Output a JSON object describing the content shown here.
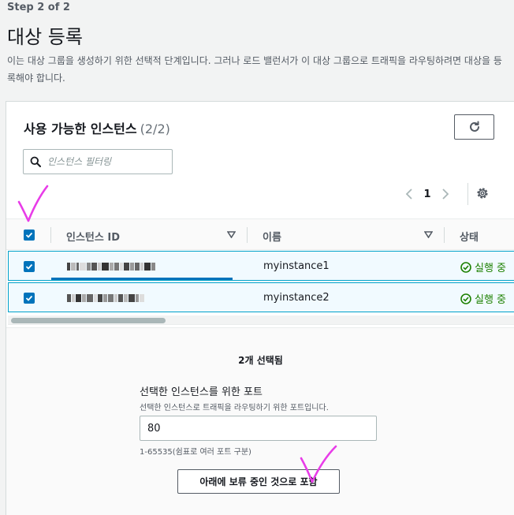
{
  "header": {
    "step": "Step 2 of 2",
    "title": "대상 등록",
    "description": "이는 대상 그룹을 생성하기 위한 선택적 단계입니다. 그러나 로드 밸런서가 이 대상 그룹으로 트래픽을 라우팅하려면 대상을 등록해야 합니다."
  },
  "instances_panel": {
    "title": "사용 가능한 인스턴스",
    "count": "(2/2)",
    "filter_placeholder": "인스턴스 필터링",
    "pagination": {
      "current_page": "1"
    },
    "columns": [
      "인스턴스 ID",
      "이름",
      "상태"
    ],
    "rows": [
      {
        "checked": true,
        "instance_id_redacted": true,
        "name": "myinstance1",
        "status": "실행 중"
      },
      {
        "checked": true,
        "instance_id_redacted": true,
        "name": "myinstance2",
        "status": "실행 중"
      }
    ],
    "header_checkbox_checked": true
  },
  "selection": {
    "selected_count_label": "2개 선택됨",
    "port_label": "선택한 인스턴스를 위한 포트",
    "port_description": "선택한 인스턴스로 트래픽을 라우팅하기 위한 포트입니다.",
    "port_value": "80",
    "port_hint": "1-65535(쉼표로 여러 포트 구분)",
    "include_button": "아래에 보류 중인 것으로 포함"
  },
  "icons": {
    "refresh": "refresh-icon",
    "search": "search-icon",
    "settings": "gear-icon",
    "prev": "chevron-left-icon",
    "next": "chevron-right-icon",
    "sort": "sort-down-icon",
    "status": "check-circle-icon"
  },
  "colors": {
    "accent": "#0073bb",
    "selected_row_bg": "#f1faff",
    "selected_row_border": "#00a1c9",
    "success": "#1d8102",
    "annotation": "#e83ce8"
  }
}
